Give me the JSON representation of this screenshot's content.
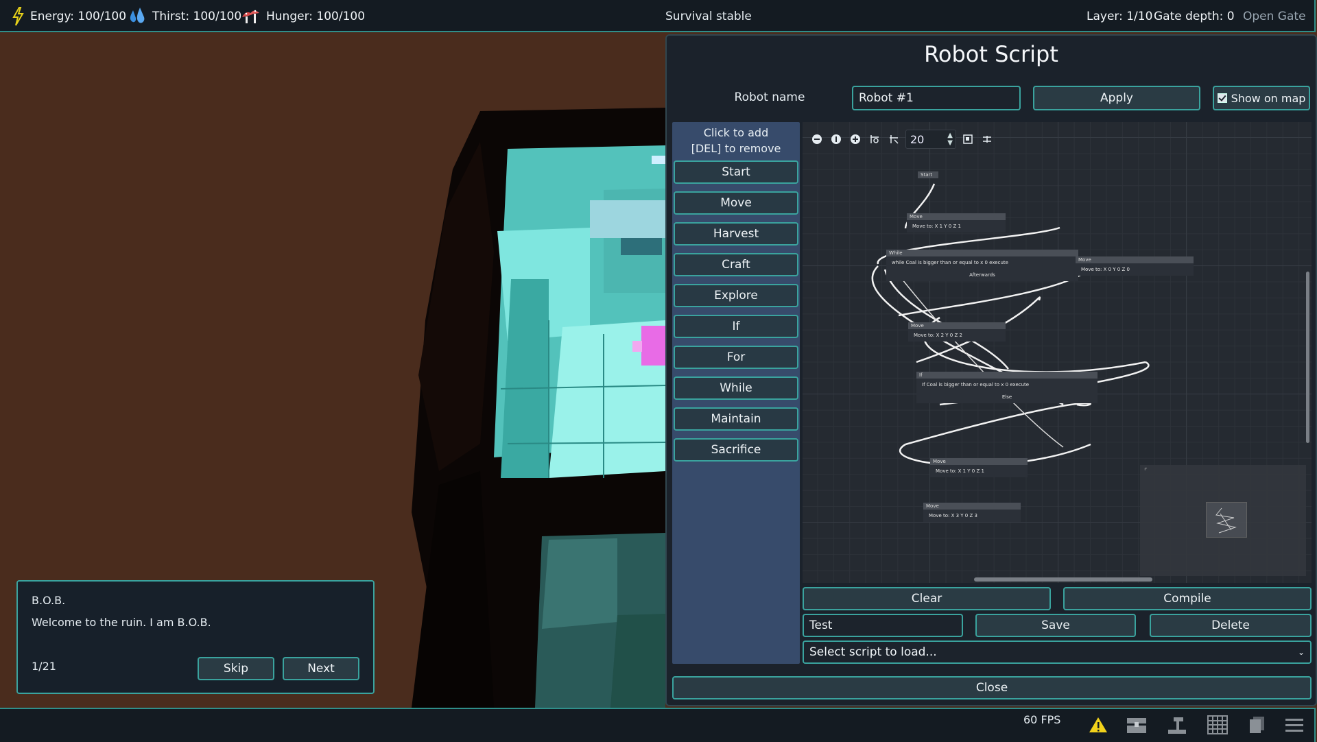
{
  "hud": {
    "energy": "Energy: 100/100",
    "thirst": "Thirst: 100/100",
    "hunger": "Hunger: 100/100",
    "status": "Survival stable",
    "layer": "Layer: 1/10",
    "gate_depth": "Gate depth: 0",
    "open_gate": "Open Gate",
    "icons": [
      "lightning-icon",
      "water-drops-icon",
      "mushroom-icon"
    ]
  },
  "robot_script": {
    "title": "Robot Script",
    "robot_name_label": "Robot name",
    "robot_name_value": "Robot #1",
    "apply_label": "Apply",
    "show_on_map_label": "Show on map",
    "show_on_map_checked": true,
    "palette_hint_line1": "Click to add",
    "palette_hint_line2": "[DEL] to remove",
    "palette": [
      "Start",
      "Move",
      "Harvest",
      "Craft",
      "Explore",
      "If",
      "For",
      "While",
      "Maintain",
      "Sacrifice"
    ],
    "zoom_value": "20",
    "graph_nodes": [
      {
        "id": "start",
        "title": "Start",
        "body": ""
      },
      {
        "id": "move1",
        "title": "Move",
        "body": "Move to:   X 1      Y 0      Z 1"
      },
      {
        "id": "while",
        "title": "While",
        "body": "while   Coal        is bigger than or equal to      x 0     execute",
        "extra": "Afterwards"
      },
      {
        "id": "move-right",
        "title": "Move",
        "body": "Move to:   X 0      Y 0      Z 0"
      },
      {
        "id": "move2",
        "title": "Move",
        "body": "Move to:   X 2      Y 0      Z 2"
      },
      {
        "id": "if",
        "title": "If",
        "body": "If   Coal         is bigger than or equal to     x 0     execute",
        "extra": "Else"
      },
      {
        "id": "move3",
        "title": "Move",
        "body": "Move to:   X 1      Y 0      Z 1"
      },
      {
        "id": "move4",
        "title": "Move",
        "body": "Move to:   X 3      Y 0      Z 3"
      }
    ],
    "clear_label": "Clear",
    "compile_label": "Compile",
    "script_name_value": "Test",
    "save_label": "Save",
    "delete_label": "Delete",
    "select_placeholder": "Select script to load...",
    "close_label": "Close"
  },
  "dialog": {
    "speaker": "B.O.B.",
    "text": "Welcome to the ruin. I am B.O.B.",
    "page": "1/21",
    "skip_label": "Skip",
    "next_label": "Next"
  },
  "bottom": {
    "fps": "60 FPS",
    "icons": [
      "warning-icon",
      "chest-icon",
      "hammer-icon",
      "grid-icon",
      "cards-icon",
      "menu-icon"
    ]
  },
  "colors": {
    "accent": "#3aa39e",
    "panel": "#1b222b",
    "palette": "#374b6b",
    "ground": "#4a2c1d",
    "cyan_block": "#5fd3cc"
  }
}
